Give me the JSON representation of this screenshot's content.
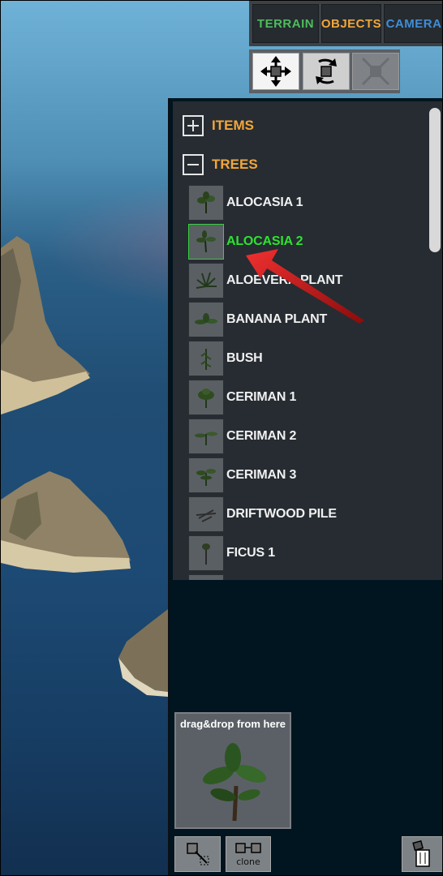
{
  "tabs": [
    {
      "label": "TERRAIN",
      "color": "#4dbd5c"
    },
    {
      "label": "OBJECTS",
      "color": "#f2a63a"
    },
    {
      "label": "CAMERA",
      "color": "#3f8ed6"
    }
  ],
  "tools": [
    {
      "icon": "move-arrows-icon"
    },
    {
      "icon": "rotate-icon"
    },
    {
      "icon": "scale-icon"
    }
  ],
  "groups": [
    {
      "label": "ITEMS",
      "expanded": false
    },
    {
      "label": "TREES",
      "expanded": true
    }
  ],
  "items": [
    {
      "name": "ALOCASIA 1"
    },
    {
      "name": "ALOCASIA 2",
      "selected": true
    },
    {
      "name": "ALOEVERA PLANT"
    },
    {
      "name": "BANANA PLANT"
    },
    {
      "name": "BUSH"
    },
    {
      "name": "CERIMAN 1"
    },
    {
      "name": "CERIMAN 2"
    },
    {
      "name": "CERIMAN 3"
    },
    {
      "name": "DRIFTWOOD PILE"
    },
    {
      "name": "FICUS 1"
    }
  ],
  "preview": {
    "caption": "drag&drop from here"
  },
  "buttons": {
    "clone_label": "clone"
  },
  "colors": {
    "selected": "#2ee230",
    "accent": "#f2a63a",
    "annotation_arrow": "#d81818"
  }
}
